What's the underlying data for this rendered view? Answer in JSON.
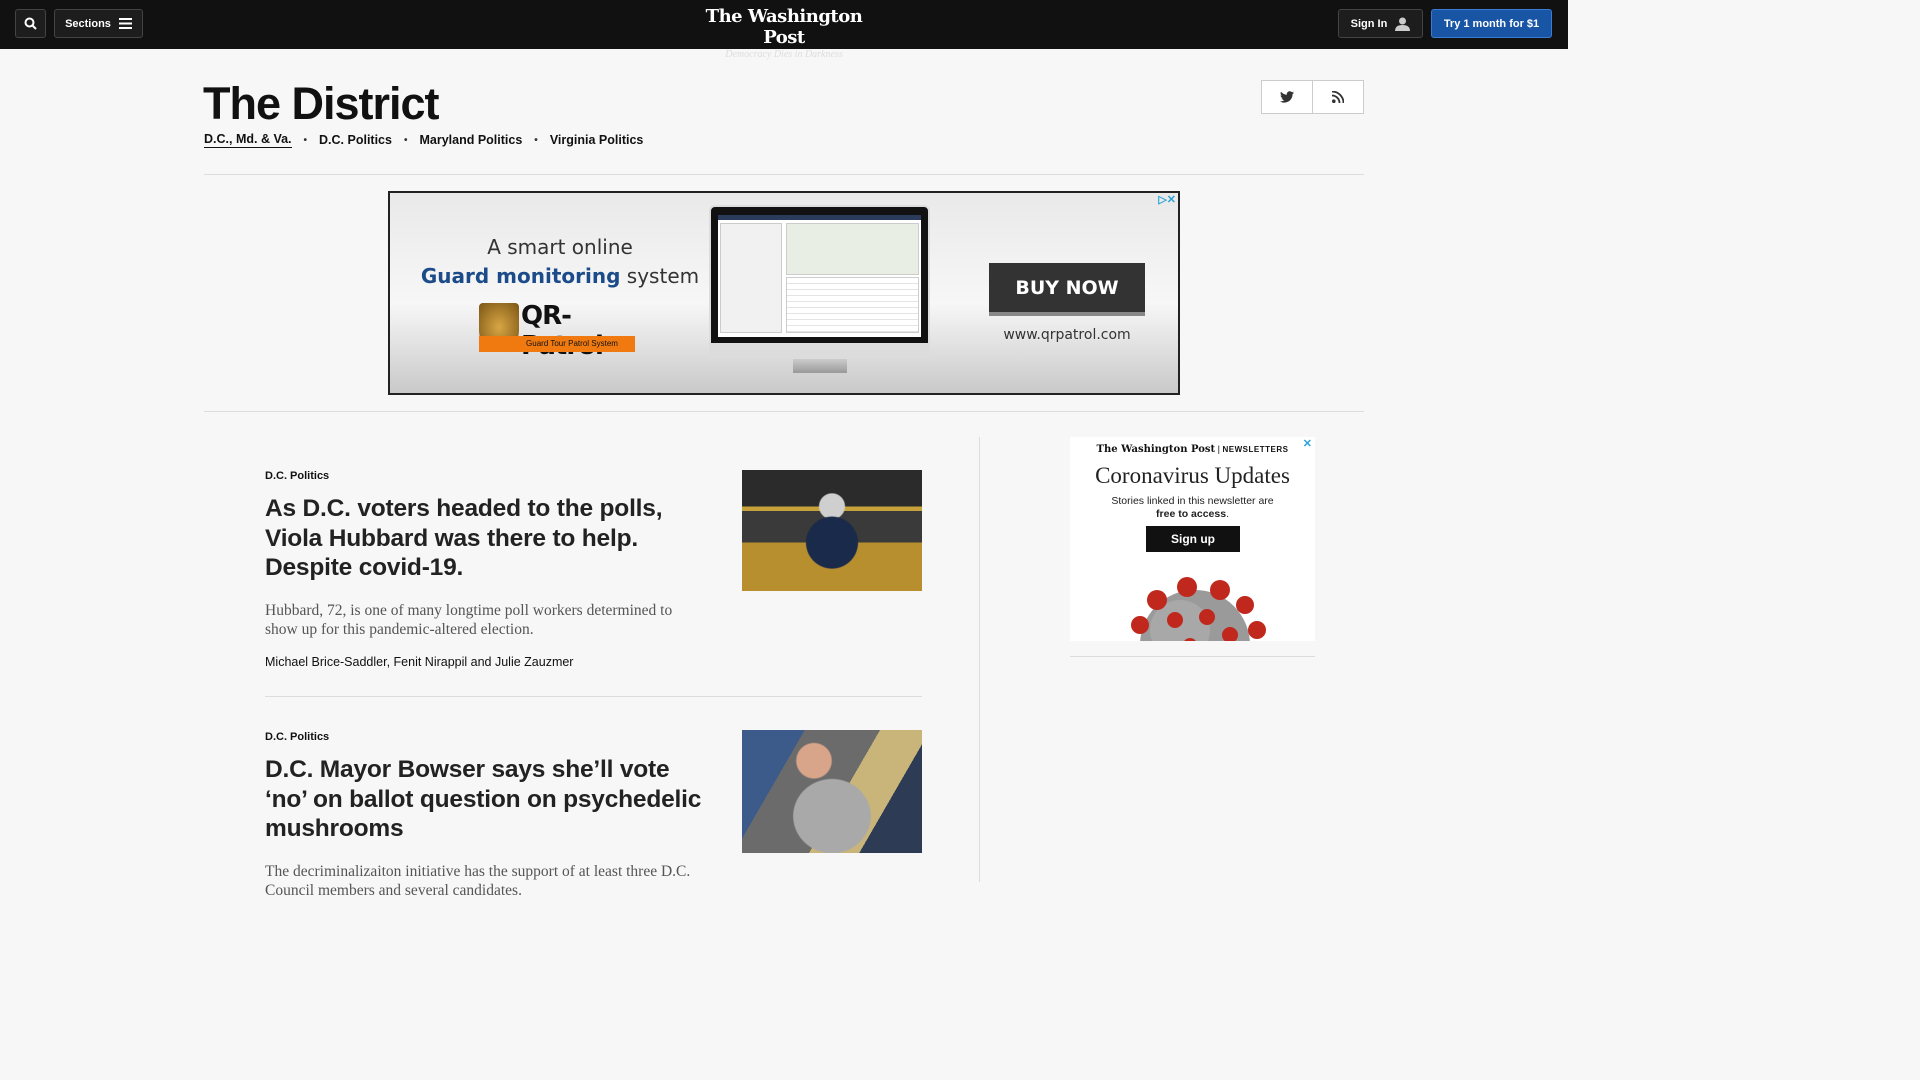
{
  "topbar": {
    "sections_label": "Sections",
    "logo_name": "The Washington Post",
    "logo_tagline": "Democracy Dies in Darkness",
    "signin_label": "Sign In",
    "subscribe_label": "Try 1 month for $1"
  },
  "section": {
    "title": "The District",
    "subnav": [
      "D.C., Md. & Va.",
      "D.C. Politics",
      "Maryland Politics",
      "Virginia Politics"
    ]
  },
  "ad": {
    "line1": "A smart online",
    "line2_bold": "Guard monitoring",
    "line2_rest": " system",
    "brand": "QR-Patrol",
    "brand_strip": "Guard Tour Patrol System",
    "cta": "BUY NOW",
    "url": "www.qrpatrol.com"
  },
  "articles": [
    {
      "kicker": "D.C. Politics",
      "headline": "As D.C. voters headed to the polls, Viola Hubbard was there to help. Despite covid-19.",
      "blurb": "Hubbard, 72, is one of many longtime poll workers determined to show up for this pandemic-altered election.",
      "byline": "Michael Brice-Saddler, Fenit Nirappil and Julie Zauzmer"
    },
    {
      "kicker": "D.C. Politics",
      "headline": "D.C. Mayor Bowser says she’ll vote ‘no’ on ballot question on psychedelic mushrooms",
      "blurb": "The decriminalizaiton initiative has the support of at least three D.C. Council members and several candidates."
    }
  ],
  "newsletter": {
    "brand": "The Washington Post",
    "label": "NEWSLETTERS",
    "title": "Coronavirus Updates",
    "desc_line1": "Stories linked in this newsletter are",
    "desc_line2": "free to access",
    "desc_period": ".",
    "cta": "Sign up"
  }
}
